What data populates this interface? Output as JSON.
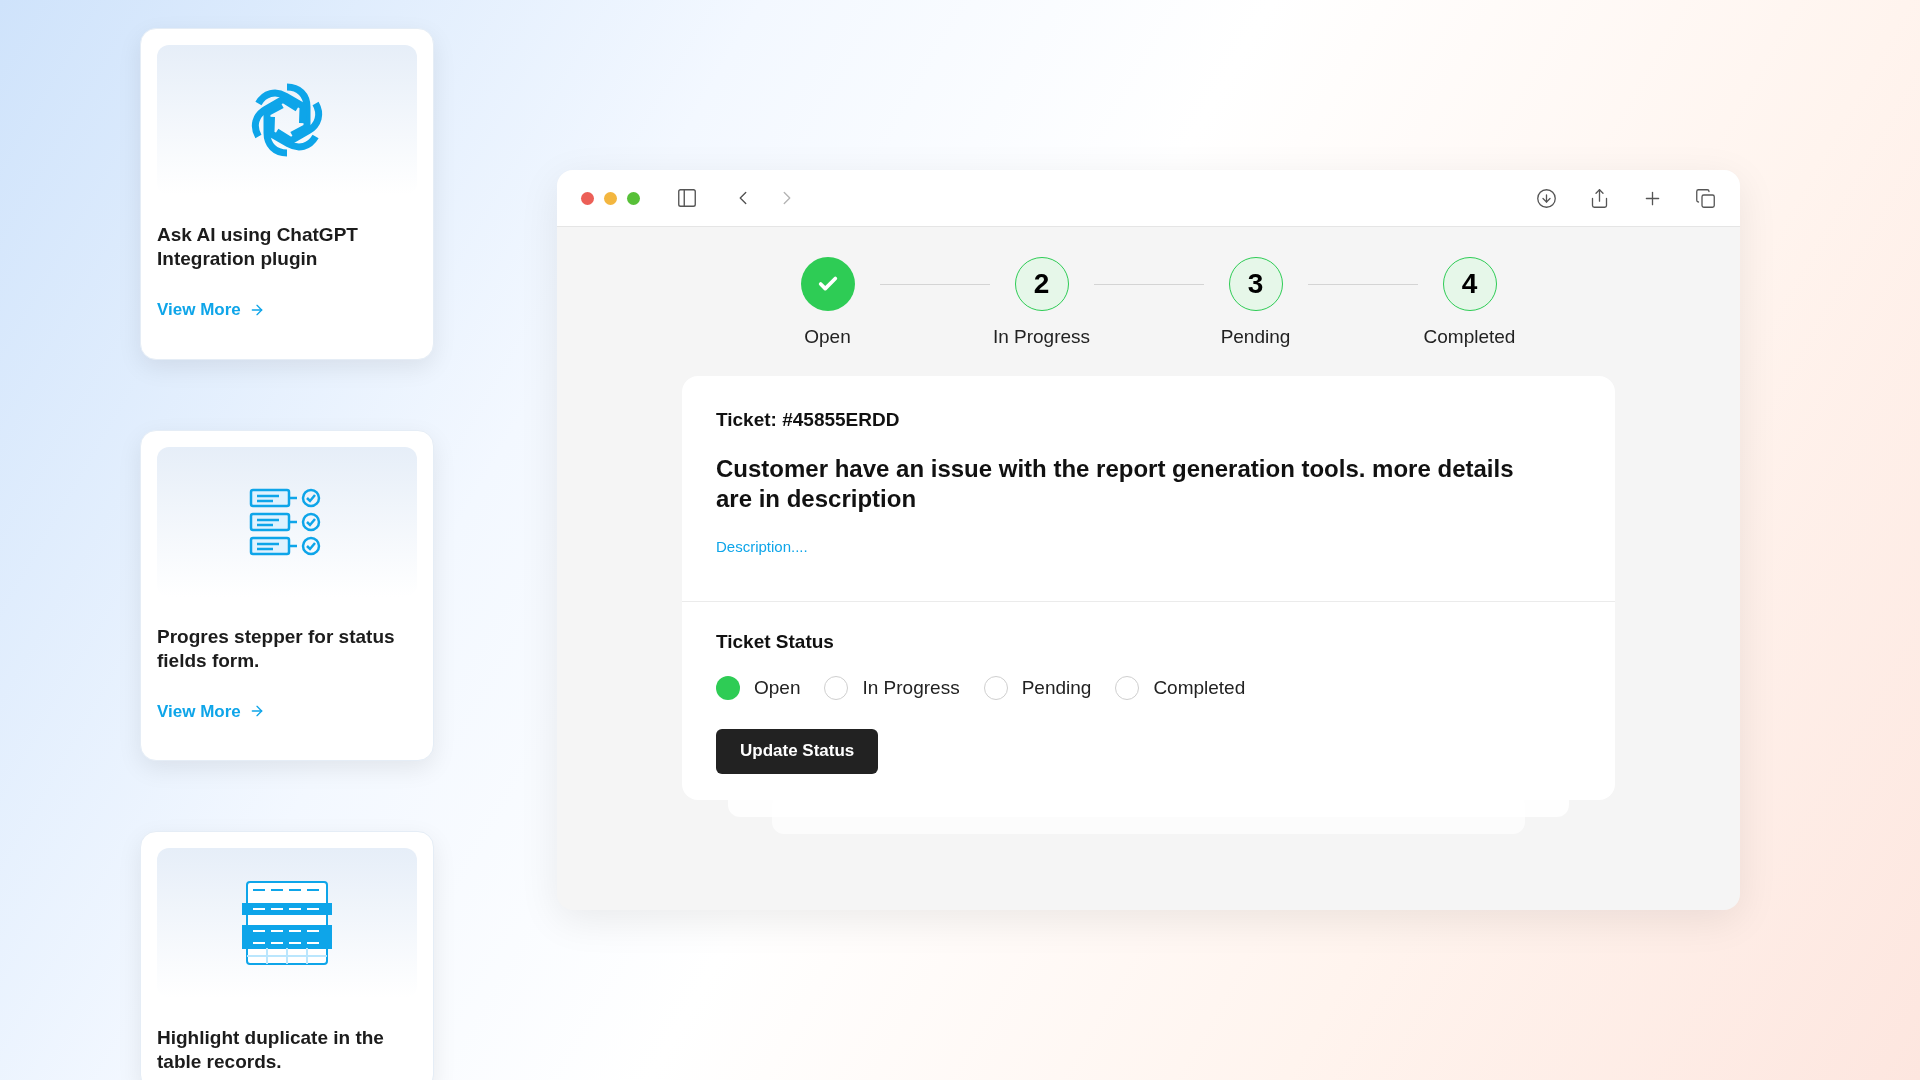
{
  "cards": [
    {
      "kind": "ai",
      "title": "Ask AI using ChatGPT Integration plugin",
      "link": "View More"
    },
    {
      "kind": "stepper",
      "title": "Progres stepper for status fields form.",
      "link": "View More"
    },
    {
      "kind": "table",
      "title": "Highlight duplicate in the table records."
    }
  ],
  "browser": {
    "forward_disabled": true
  },
  "steps": [
    {
      "label": "Open",
      "done": true
    },
    {
      "number": "2",
      "label": "In Progress",
      "done": false
    },
    {
      "number": "3",
      "label": "Pending",
      "done": false
    },
    {
      "number": "4",
      "label": "Completed",
      "done": false
    }
  ],
  "ticket": {
    "id": "Ticket: #45855ERDD",
    "summary": "Customer have an issue with the report generation tools. more details are in description",
    "description_link": "Description...."
  },
  "status": {
    "title": "Ticket Status",
    "options": [
      {
        "label": "Open",
        "selected": true
      },
      {
        "label": "In Progress",
        "selected": false
      },
      {
        "label": "Pending",
        "selected": false
      },
      {
        "label": "Completed",
        "selected": false
      }
    ],
    "button": "Update Status"
  }
}
